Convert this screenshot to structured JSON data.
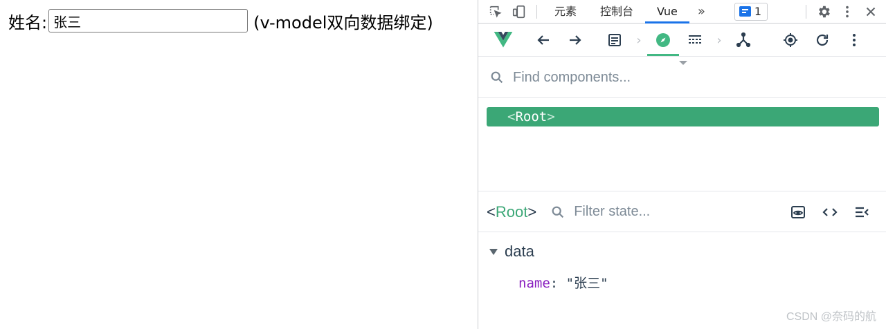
{
  "page": {
    "label": "姓名:",
    "input_value": "张三",
    "hint": "(v-model双向数据绑定)"
  },
  "devtools": {
    "tabs": [
      "元素",
      "控制台",
      "Vue"
    ],
    "active_tab": "Vue",
    "more_tabs": "»",
    "issues_count": "1",
    "colors": {
      "vue_green": "#42b883",
      "selected_row": "#3ba776",
      "tab_underline": "#1a73e8"
    }
  },
  "vue_panel": {
    "search_placeholder": "Find components...",
    "tree": {
      "open": "<",
      "name": "Root",
      "close": ">"
    },
    "selected_component": {
      "open": "<",
      "name": "Root",
      "close": ">"
    },
    "filter_placeholder": "Filter state...",
    "section": "data",
    "prop": {
      "key": "name",
      "colon": ": ",
      "value": "\"张三\""
    }
  },
  "watermark": "CSDN @奈码的航"
}
